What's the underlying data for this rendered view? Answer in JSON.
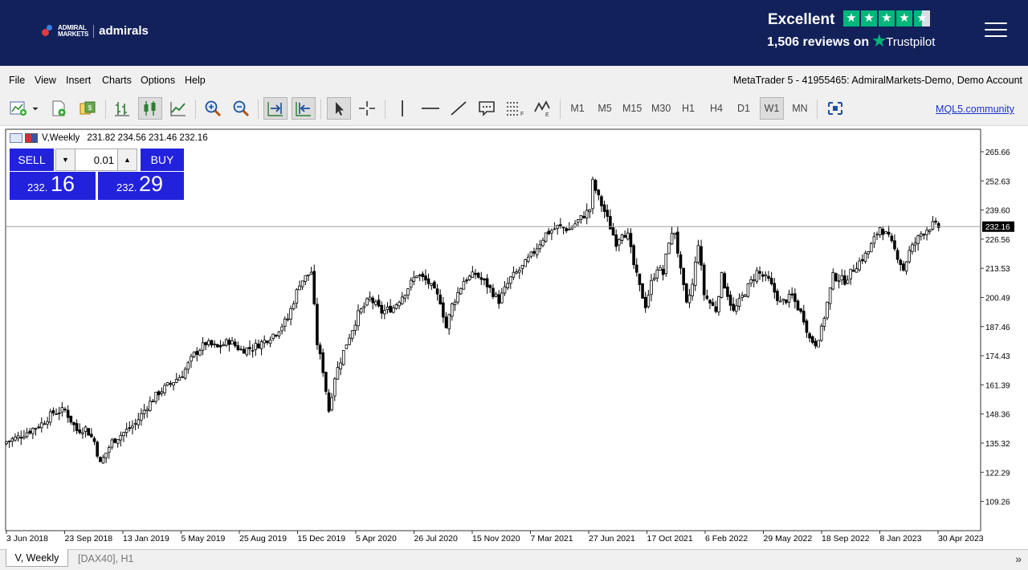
{
  "header": {
    "brand": {
      "line1": "ADMIRAL",
      "line2": "MARKETS",
      "name": "admirals"
    },
    "trustpilot": {
      "rating": "Excellent",
      "reviews": "1,506 reviews on",
      "logo": "Trustpilot",
      "stars": 4.5
    },
    "menu_icon": "hamburger-icon"
  },
  "menu": {
    "items": [
      "File",
      "View",
      "Insert",
      "Charts",
      "Options",
      "Help"
    ],
    "window_title": "MetaTrader 5 - 41955465: AdmiralMarkets-Demo, Demo Account"
  },
  "toolbar": {
    "icons": [
      "new-chart-icon",
      "dropdown-arrow-icon",
      "new-order-icon",
      "market-watch-icon",
      "bar-chart-icon",
      "candlestick-icon",
      "line-chart-icon",
      "zoom-in-icon",
      "zoom-out-icon",
      "chart-shift-icon",
      "autoscroll-icon",
      "cursor-icon",
      "crosshair-icon",
      "vertical-line-icon",
      "horizontal-line-icon",
      "trendline-icon",
      "text-label-icon",
      "fibonacci-icon",
      "elliott-wave-icon",
      "object-list-icon"
    ],
    "timeframes": [
      "M1",
      "M5",
      "M15",
      "M30",
      "H1",
      "H4",
      "D1",
      "W1",
      "MN"
    ],
    "active_timeframe": "W1",
    "community_link": "MQL5.community"
  },
  "chart_header": {
    "symbol": "V,Weekly",
    "ohlc": "231.82 234.56 231.46 232.16"
  },
  "trade_panel": {
    "sell_label": "SELL",
    "buy_label": "BUY",
    "lot": "0.01",
    "sell_price_small": "232.",
    "sell_price_big": "16",
    "buy_price_small": "232.",
    "buy_price_big": "29",
    "panel_color": "#2222dd"
  },
  "chart_data": {
    "type": "candlestick",
    "symbol": "V",
    "timeframe": "Weekly",
    "current_price": "232.16",
    "y_ticks": [
      265.66,
      252.63,
      239.6,
      226.56,
      213.53,
      200.49,
      187.46,
      174.43,
      161.39,
      148.36,
      135.32,
      122.29,
      109.26
    ],
    "x_labels": [
      "3 Jun 2018",
      "23 Sep 2018",
      "13 Jan 2019",
      "5 May 2019",
      "25 Aug 2019",
      "15 Dec 2019",
      "5 Apr 2020",
      "26 Jul 2020",
      "15 Nov 2020",
      "7 Mar 2021",
      "27 Jun 2021",
      "17 Oct 2021",
      "6 Feb 2022",
      "29 May 2022",
      "18 Sep 2022",
      "8 Jan 2023",
      "30 Apr 2023"
    ],
    "close_path": [
      [
        0,
        136
      ],
      [
        4,
        138
      ],
      [
        8,
        141
      ],
      [
        12,
        144
      ],
      [
        16,
        149
      ],
      [
        20,
        150
      ],
      [
        24,
        141
      ],
      [
        27,
        142
      ],
      [
        30,
        136
      ],
      [
        32,
        126
      ],
      [
        36,
        136
      ],
      [
        40,
        140
      ],
      [
        44,
        144
      ],
      [
        48,
        152
      ],
      [
        52,
        158
      ],
      [
        56,
        162
      ],
      [
        60,
        166
      ],
      [
        64,
        175
      ],
      [
        68,
        180
      ],
      [
        72,
        178
      ],
      [
        76,
        181
      ],
      [
        80,
        177
      ],
      [
        84,
        178
      ],
      [
        88,
        181
      ],
      [
        92,
        185
      ],
      [
        96,
        191
      ],
      [
        100,
        207
      ],
      [
        104,
        212
      ],
      [
        106,
        180
      ],
      [
        108,
        168
      ],
      [
        110,
        150
      ],
      [
        112,
        165
      ],
      [
        116,
        180
      ],
      [
        120,
        193
      ],
      [
        124,
        200
      ],
      [
        128,
        194
      ],
      [
        132,
        196
      ],
      [
        136,
        203
      ],
      [
        140,
        211
      ],
      [
        144,
        207
      ],
      [
        148,
        199
      ],
      [
        150,
        187
      ],
      [
        152,
        197
      ],
      [
        156,
        208
      ],
      [
        160,
        211
      ],
      [
        164,
        206
      ],
      [
        168,
        199
      ],
      [
        172,
        209
      ],
      [
        176,
        214
      ],
      [
        180,
        221
      ],
      [
        184,
        229
      ],
      [
        188,
        232
      ],
      [
        192,
        231
      ],
      [
        196,
        236
      ],
      [
        199,
        240
      ],
      [
        200,
        252
      ],
      [
        202,
        245
      ],
      [
        204,
        239
      ],
      [
        206,
        232
      ],
      [
        208,
        225
      ],
      [
        210,
        230
      ],
      [
        212,
        228
      ],
      [
        214,
        215
      ],
      [
        216,
        205
      ],
      [
        218,
        197
      ],
      [
        220,
        207
      ],
      [
        222,
        214
      ],
      [
        224,
        211
      ],
      [
        226,
        226
      ],
      [
        228,
        230
      ],
      [
        230,
        212
      ],
      [
        232,
        197
      ],
      [
        234,
        206
      ],
      [
        236,
        225
      ],
      [
        238,
        202
      ],
      [
        240,
        198
      ],
      [
        242,
        195
      ],
      [
        244,
        210
      ],
      [
        248,
        194
      ],
      [
        252,
        203
      ],
      [
        256,
        212
      ],
      [
        260,
        208
      ],
      [
        264,
        198
      ],
      [
        268,
        201
      ],
      [
        272,
        191
      ],
      [
        274,
        182
      ],
      [
        276,
        180
      ],
      [
        278,
        186
      ],
      [
        282,
        210
      ],
      [
        286,
        208
      ],
      [
        290,
        215
      ],
      [
        294,
        221
      ],
      [
        298,
        232
      ],
      [
        301,
        227
      ],
      [
        304,
        219
      ],
      [
        306,
        213
      ],
      [
        308,
        221
      ],
      [
        312,
        229
      ],
      [
        316,
        233
      ],
      [
        318,
        232
      ]
    ],
    "series_color": "#000000"
  },
  "tabs": {
    "items": [
      "V, Weekly",
      "[DAX40], H1"
    ],
    "active": "V, Weekly",
    "scroll": "»"
  }
}
